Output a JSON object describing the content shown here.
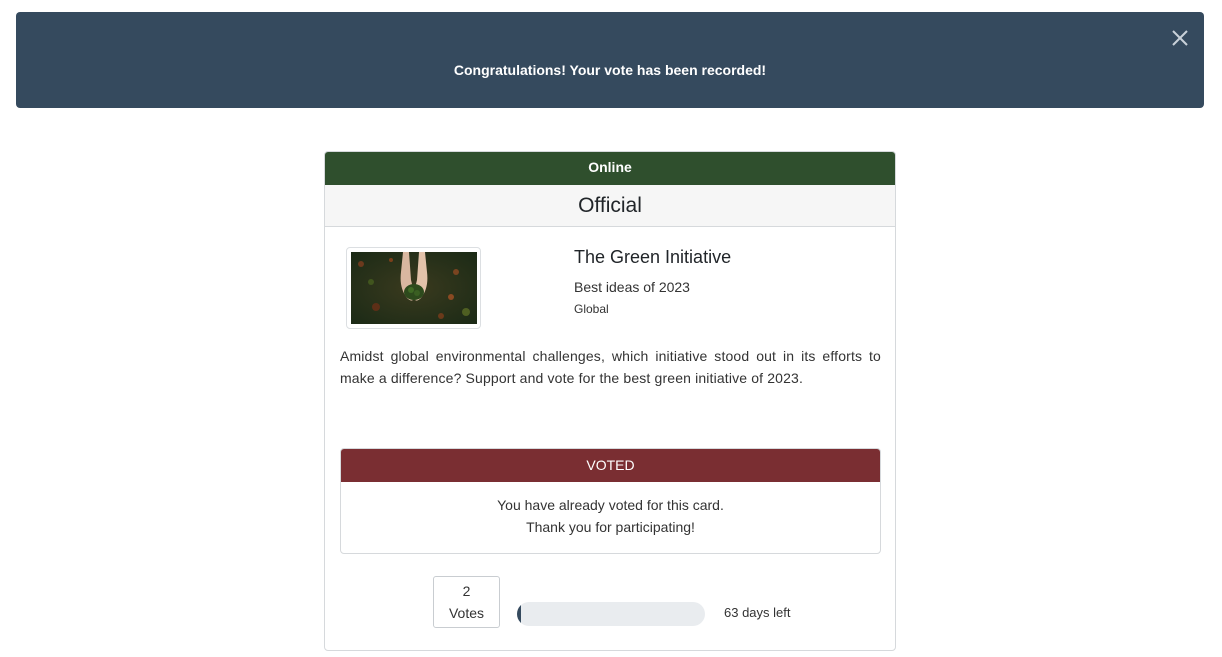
{
  "toast": {
    "message": "Congratulations! Your vote has been recorded!",
    "close_icon": "close-icon"
  },
  "card": {
    "status": "Online",
    "type": "Official",
    "title": "The Green Initiative",
    "subtitle": "Best ideas of 2023",
    "scope": "Global",
    "description": "Amidst global environmental challenges, which initiative stood out in its efforts to make a difference? Support and vote for the best green initiative of 2023.",
    "image_icon": "hands-holding-plant-image",
    "voted": {
      "label": "VOTED",
      "line1": "You have already voted for this card.",
      "line2": "Thank you for participating!"
    },
    "votes": {
      "count": "2",
      "label": "Votes"
    },
    "progress_fraction": 0.02,
    "days_left": "63 days left"
  },
  "colors": {
    "toast_bg": "#354a5e",
    "status_bg": "#2f4f2d",
    "voted_bg": "#7a2e32",
    "progress_fill": "#354a5e"
  }
}
